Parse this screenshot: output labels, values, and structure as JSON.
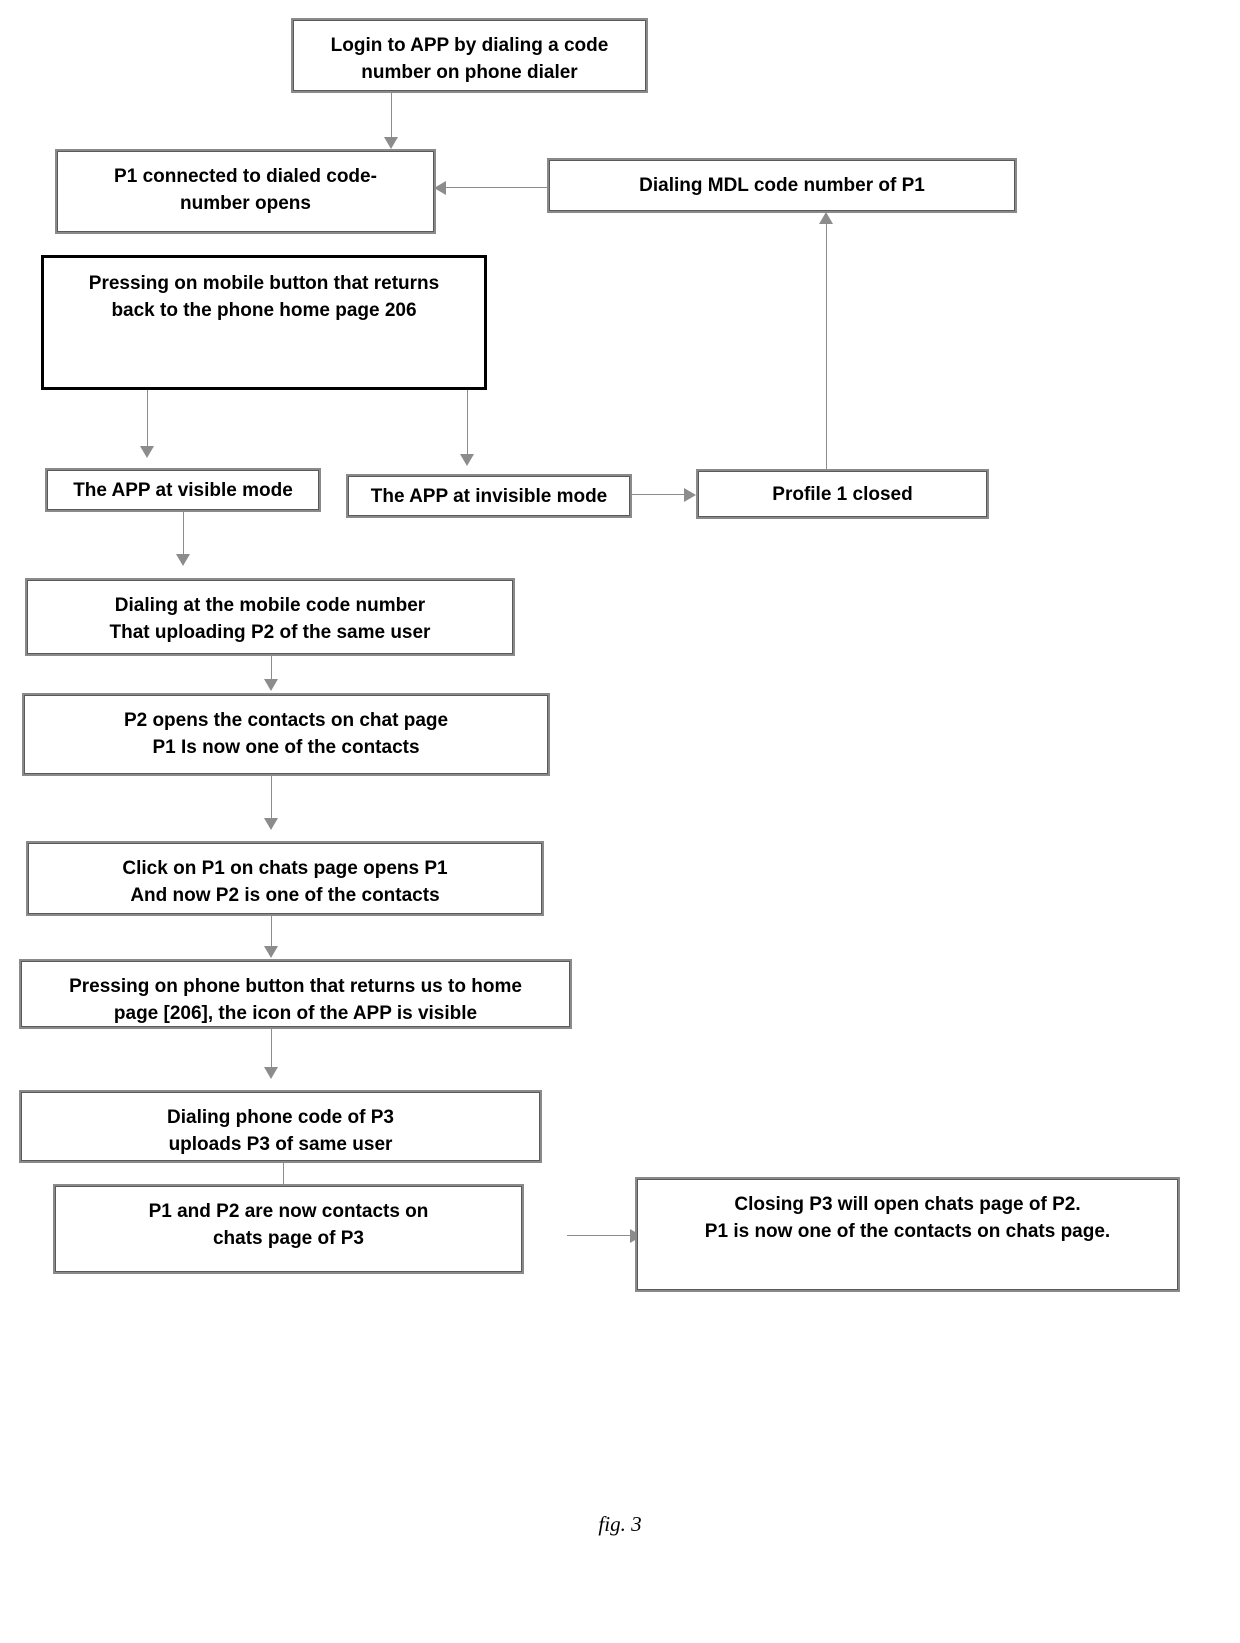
{
  "figure": {
    "caption": "fig. 3",
    "accent_border": "#8a8a8a",
    "emphasis_border": "#000000",
    "connector_color": "#8c8c8c",
    "background": "#ffffff"
  },
  "nodes": {
    "login": {
      "label": "Login to APP by dialing a code\nnumber on phone dialer"
    },
    "p1_connected": {
      "label": "P1 connected to dialed code-\nnumber opens"
    },
    "dialing_mdl": {
      "label": "Dialing MDL code number of P1"
    },
    "pressing_mobile_button": {
      "label": "Pressing on mobile button that returns\nback to the phone home page 206"
    },
    "app_visible": {
      "label": "The APP at visible mode"
    },
    "app_invisible": {
      "label": "The APP at invisible mode"
    },
    "profile_closed": {
      "label": "Profile 1 closed"
    },
    "dialing_mobile_code": {
      "label": "Dialing at the mobile code number\nThat uploading P2 of the same user"
    },
    "p2_opens_contacts": {
      "label": "P2 opens the contacts on chat page\nP1 Is now one of the contacts"
    },
    "click_p1": {
      "label": "Click on P1 on chats page opens P1\nAnd now P2 is one of  the contacts"
    },
    "pressing_phone_button": {
      "label": "Pressing on phone button that returns us to home\npage [206], the icon of the APP is visible"
    },
    "dialing_p3": {
      "label": "Dialing phone code of  P3\nuploads P3 of same user"
    },
    "p1_p2_contacts_p3": {
      "label": "P1 and P2 are now contacts on\nchats page of P3"
    },
    "closing_p3": {
      "label": "Closing P3 will  open chats page of  P2.\nP1 is now one of the contacts on chats page."
    }
  }
}
